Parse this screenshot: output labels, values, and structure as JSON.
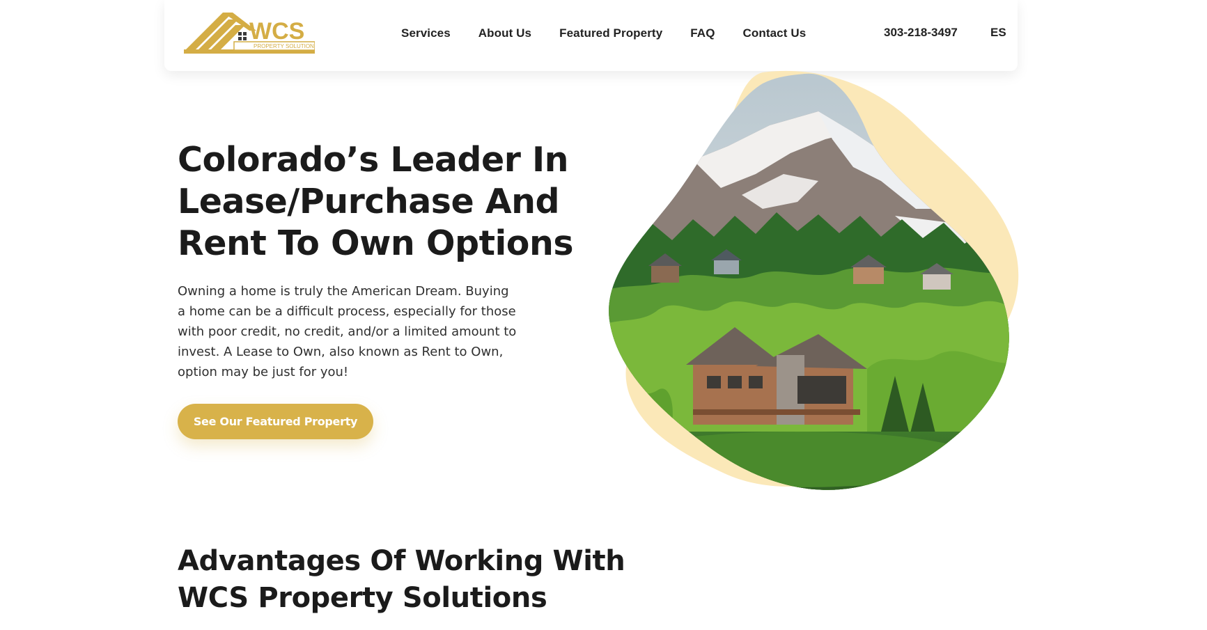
{
  "header": {
    "logo_text": "WCS",
    "logo_subtext": "PROPERTY SOLUTIONS",
    "nav": [
      {
        "label": "Services"
      },
      {
        "label": "About Us"
      },
      {
        "label": "Featured Property"
      },
      {
        "label": "FAQ"
      },
      {
        "label": "Contact Us"
      }
    ],
    "phone": "303-218-3497",
    "language": "ES"
  },
  "hero": {
    "title_line1": "Colorado’s Leader In",
    "title_line2": "Lease/Purchase And",
    "title_line3": "Rent To Own Options",
    "paragraph": "Owning a home is truly the American Dream. Buying a home can be a difficult process, especially for those with poor credit, no credit, and/or a limited amount to invest. A Lease to Own, also known as Rent to Own, option may be just for you!",
    "cta_label": "See Our Featured Property"
  },
  "advantages": {
    "title_line1": "Advantages Of Working With",
    "title_line2": "WCS Property Solutions"
  },
  "colors": {
    "accent": "#d8b24a",
    "blob_back": "#fbe8b8",
    "text": "#1b1b1b"
  }
}
